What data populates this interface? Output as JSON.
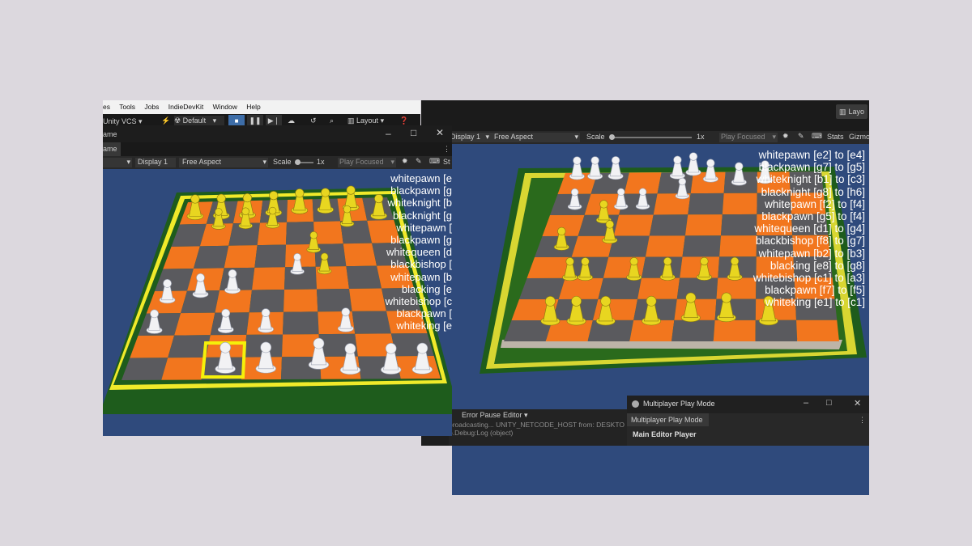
{
  "menubar": {
    "items": [
      "es",
      "Tools",
      "Jobs",
      "IndieDevKit",
      "Window",
      "Help"
    ]
  },
  "editor_toolbar": {
    "vcs": "Unity VCS",
    "layer": "Default",
    "layout": "Layout"
  },
  "left_window": {
    "title": "ame",
    "tab": "ame",
    "display": "Display 1",
    "aspect": "Free Aspect",
    "scale_label": "Scale",
    "scale_value": "1x",
    "play_focused": "Play Focused",
    "stats": "St"
  },
  "left_log": [
    "whitepawn [e",
    "blackpawn [g",
    "whiteknight [b",
    "blacknight [g",
    "whitepawn [",
    "blackpawn [g",
    "whitequeen [d",
    "blackbishop [",
    "whitepawn [b",
    "blacking [e",
    "whitebishop [c",
    "blackpawn [",
    "whiteking [e"
  ],
  "right_window": {
    "layout": "Layo",
    "display": "Display 1",
    "aspect": "Free Aspect",
    "scale_label": "Scale",
    "scale_value": "1x",
    "play_focused": "Play Focused",
    "stats": "Stats",
    "gizmos": "Gizmo"
  },
  "right_log": [
    "whitepawn [e2] to [e4]",
    "blackpawn [g7] to [g5]",
    "whiteknight [b1] to [c3]",
    "blacknight [g8] to [h6]",
    "whitepawn [f2] to [f4]",
    "blackpawn [g5] to [f4]",
    "whitequeen [d1] to [g4]",
    "blackbishop [f8] to [g7]",
    "whitepawn [b2] to [b3]",
    "blacking [e8] to [g8]",
    "whitebishop [c1] to [a3]",
    "blackpawn [f7] to [f5]",
    "whiteking [e1] to [c1]"
  ],
  "console": {
    "error_pause": "Error Pause",
    "editor": "Editor",
    "line1": "broadcasting... UNITY_NETCODE_HOST from: DESKTO",
    "line2": "o.Debug:Log (object)"
  },
  "mppm": {
    "title": "Multiplayer Play Mode",
    "tab": "Multiplayer Play Mode",
    "main_player": "Main Editor Player"
  },
  "colors": {
    "background": "#dcd8de",
    "sky": "#2f4a7c",
    "orange": "#f2761e",
    "gray_square": "#5a5a5e",
    "frame_green": "#1e5c1c",
    "frame_yellow": "#f2ee3a",
    "white_piece": "#f2f2f4",
    "yellow_piece": "#e8d620",
    "editor_dark": "#1e1e1e"
  }
}
